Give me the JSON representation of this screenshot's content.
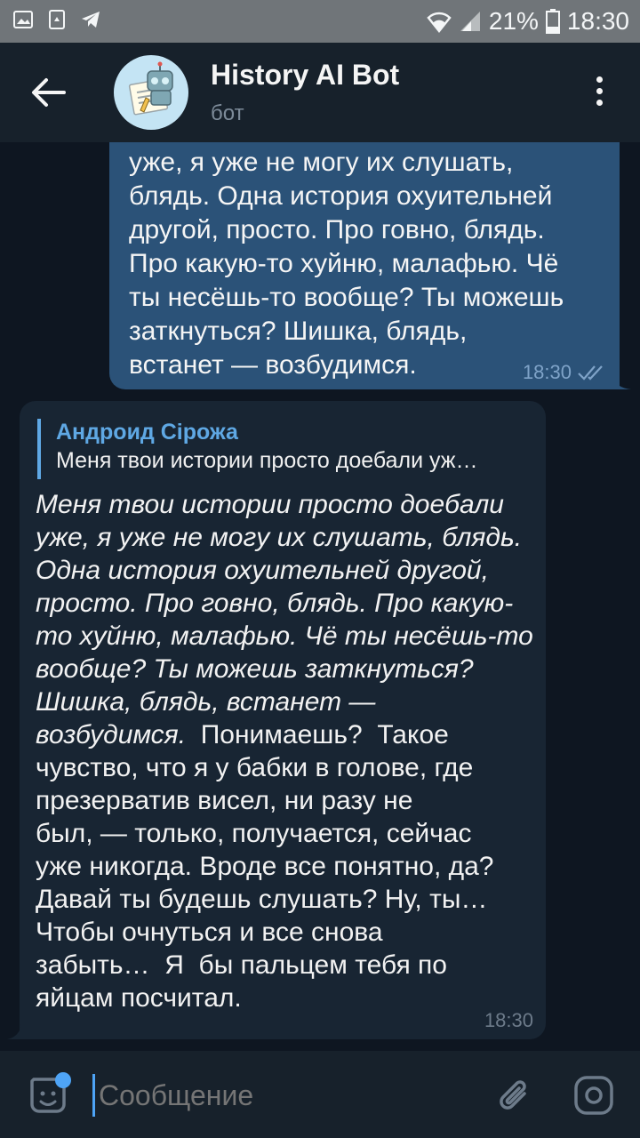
{
  "status_bar": {
    "battery": "21%",
    "time": "18:30",
    "icons": [
      "gallery-icon",
      "recycle-icon",
      "telegram-icon",
      "wifi-icon",
      "signal-icon",
      "battery-icon"
    ]
  },
  "header": {
    "title": "History AI Bot",
    "subtitle": "бот",
    "icons": [
      "back-arrow-icon",
      "robot-avatar",
      "more-vertical-icon"
    ]
  },
  "messages": {
    "outgoing": {
      "text": "уже, я уже не могу их слушать,\nблядь. Одна история охуительней\nдругой, просто. Про говно, блядь.\nПро какую-то хуйню, малафью. Чё\nты несёшь-то вообще? Ты можешь\nзаткнуться? Шишка, блядь,\nвстанет — возбудимся.",
      "time": "18:30",
      "status_icon": "double-check-icon"
    },
    "incoming": {
      "reply_name": "Андроид Сірожа",
      "reply_text": "Меня твои истории просто доебали уж…",
      "quoted_italic": "Меня твои истории просто доебали\nуже, я уже не могу их слушать, блядь.\nОдна история охуительней другой,\nпросто. Про говно, блядь. Про какую-\nто хуйню, малафью. Чё ты несёшь-то\nвообще? Ты можешь заткнуться?\nШишка, блядь, встанет —\nвозбудимся.",
      "text_after": "  Понимаешь?  Такое\nчувство, что я у бабки в голове, где\nпрезерватив висел, ни разу не\nбыл, — только, получается, сейчас\nуже никогда. Вроде все понятно, да?\nДавай ты будешь слушать? Ну, ты…\nЧтобы очнуться и все снова\nзабыть…  Я  бы пальцем тебя по\nяйцам посчитал.",
      "time": "18:30"
    }
  },
  "input_bar": {
    "placeholder": "Сообщение",
    "icons": [
      "sticker-icon",
      "attach-icon",
      "camera-icon"
    ]
  },
  "colors": {
    "background": "#0e1621",
    "header": "#17212b",
    "outgoing_bubble": "#2b5278",
    "incoming_bubble": "#182533",
    "accent": "#5fa8e4"
  }
}
